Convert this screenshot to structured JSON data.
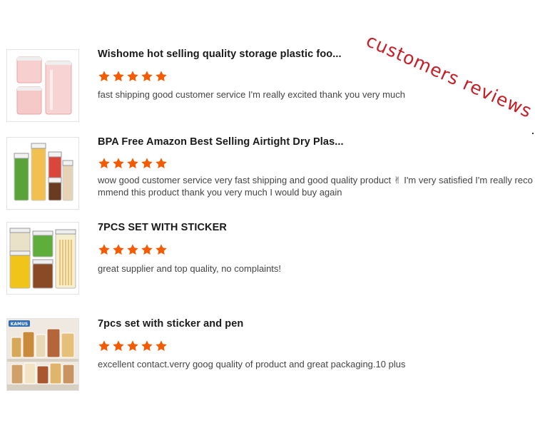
{
  "overlay": {
    "stamp_text": "customers reviews",
    "stamp_color": "#c81d25"
  },
  "reviews": [
    {
      "title": "Wishome hot selling quality storage plastic foo...",
      "rating": 5,
      "text": "fast shipping good customer service I'm really excited thank you very much",
      "image": "pink-food-containers-image"
    },
    {
      "title": "BPA Free Amazon Best Selling Airtight Dry Plas...",
      "rating": 5,
      "text": "wow good customer service very fast shipping and good quality product ✌ I'm very satisfied I'm really recommend this product thank you very much I would buy again",
      "image": "airtight-containers-image"
    },
    {
      "title": "7PCS SET WITH STICKER",
      "rating": 5,
      "text": "great supplier and top quality, no complaints!",
      "image": "seven-piece-set-image"
    },
    {
      "title": "7pcs set with sticker and pen",
      "rating": 5,
      "text": "excellent contact.verry goog quality of product and great packaging.10 plus",
      "image": "kitchen-shelf-containers-image",
      "image_label": "KAMUS"
    }
  ],
  "colors": {
    "star": "#f25c05",
    "title": "#1a1a1a",
    "body": "#444444"
  }
}
